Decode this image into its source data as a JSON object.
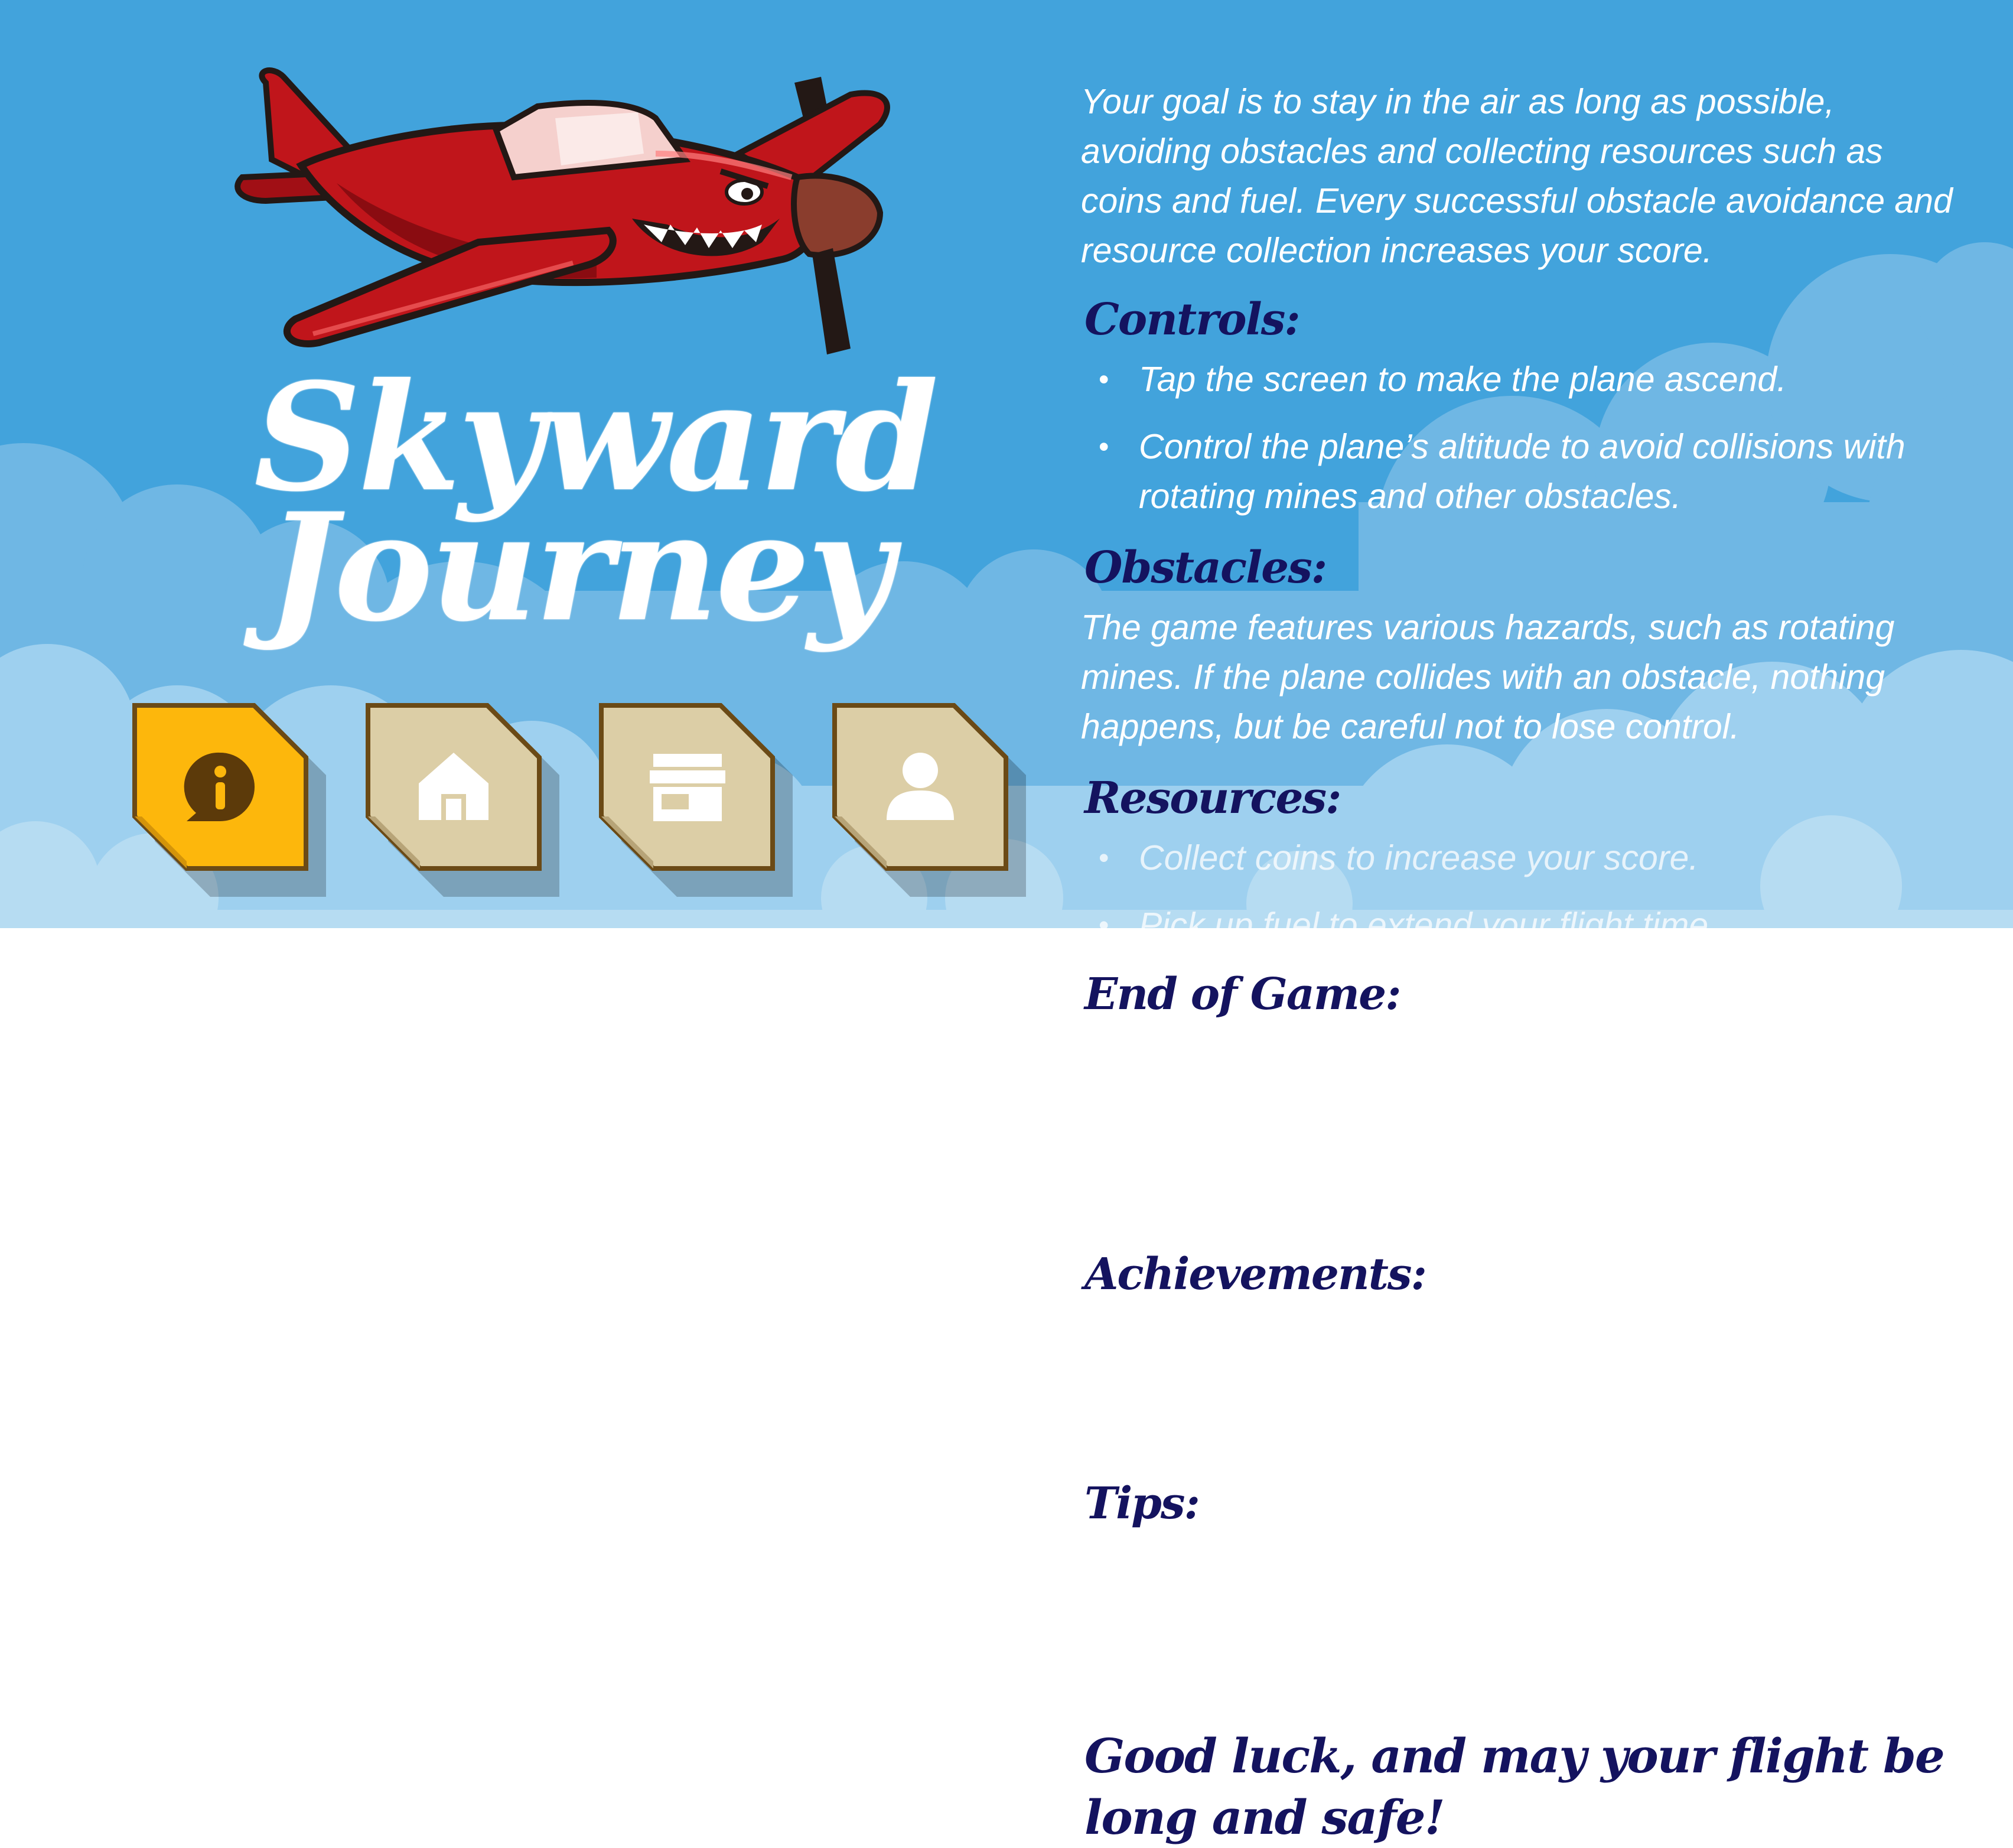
{
  "game": {
    "title_line1": "Skyward",
    "title_line2": "Journey"
  },
  "menu": {
    "buttons": [
      {
        "icon": "info-icon",
        "state": "active"
      },
      {
        "icon": "home-icon",
        "state": "inactive"
      },
      {
        "icon": "shop-icon",
        "state": "inactive"
      },
      {
        "icon": "profile-icon",
        "state": "inactive"
      }
    ]
  },
  "rules": {
    "intro": "Your goal is to stay in the air as long as possible, avoiding obstacles and collecting resources such as coins and fuel. Every successful obstacle avoidance and resource collection increases your score.",
    "controls_heading": "Controls:",
    "controls": [
      "Tap the screen to make the plane ascend.",
      "Control the plane’s altitude to avoid collisions with rotating mines and other obstacles."
    ],
    "obstacles_heading": "Obstacles:",
    "obstacles_text": "The game features various hazards, such as rotating mines. If the plane collides with an obstacle, nothing happens, but be careful not to lose control.",
    "resources_heading": "Resources:",
    "resources": [
      "Collect coins to increase your score.",
      "Pick up fuel to extend your flight time."
    ],
    "end_heading": "End of Game:",
    "achievements_heading": "Achievements:",
    "tips_heading": "Tips:",
    "closing": "Good luck, and may your flight be long and safe!"
  },
  "colors": {
    "sky": "#42a3dc",
    "heading": "#14135f",
    "active_button": "#fdb70c",
    "inactive_button": "#dccea6",
    "button_outline": "#6b4a16"
  }
}
